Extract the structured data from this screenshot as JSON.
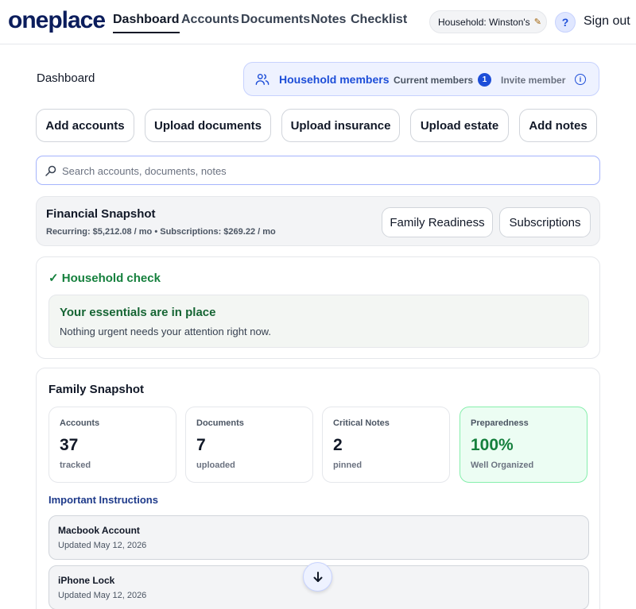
{
  "header": {
    "logo": "oneplace",
    "nav": [
      "Dashboard",
      "Accounts",
      "Documents",
      "Notes",
      "Checklist"
    ],
    "household_label": "Household: Winston's",
    "help_label": "?",
    "signout_label": "Sign out"
  },
  "page_title": "Dashboard",
  "members": {
    "title": "Household members",
    "current_label": "Current members",
    "count": "1",
    "invite_label": "Invite member",
    "info_label": "i"
  },
  "actions": [
    "Add accounts",
    "Upload documents",
    "Upload insurance",
    "Upload estate",
    "Add notes"
  ],
  "search": {
    "placeholder": "Search accounts, documents, notes"
  },
  "financial": {
    "title": "Financial Snapshot",
    "summary": "Recurring: $5,212.08 / mo • Subscriptions: $269.22 / mo",
    "buttons": [
      "Family Readiness",
      "Subscriptions"
    ]
  },
  "household_check": {
    "title": "✓ Household check",
    "status_title": "Your essentials are in place",
    "status_text": "Nothing urgent needs your attention right now."
  },
  "family_snapshot": {
    "title": "Family Snapshot",
    "stats": [
      {
        "label": "Accounts",
        "value": "37",
        "unit": "tracked"
      },
      {
        "label": "Documents",
        "value": "7",
        "unit": "uploaded"
      },
      {
        "label": "Critical Notes",
        "value": "2",
        "unit": "pinned"
      },
      {
        "label": "Preparedness",
        "value": "100%",
        "unit": "Well Organized"
      }
    ],
    "instructions_title": "Important Instructions",
    "instructions": [
      {
        "name": "Macbook Account",
        "updated": "Updated May 12, 2026"
      },
      {
        "name": "iPhone Lock",
        "updated": "Updated May 12, 2026"
      }
    ]
  },
  "colors": {
    "brand": "#0b1d5c",
    "accent": "#1d4ed8",
    "success": "#15803d"
  },
  "icons": [
    "people-icon",
    "info-icon",
    "search-icon",
    "pencil-icon",
    "arrow-down-icon"
  ]
}
